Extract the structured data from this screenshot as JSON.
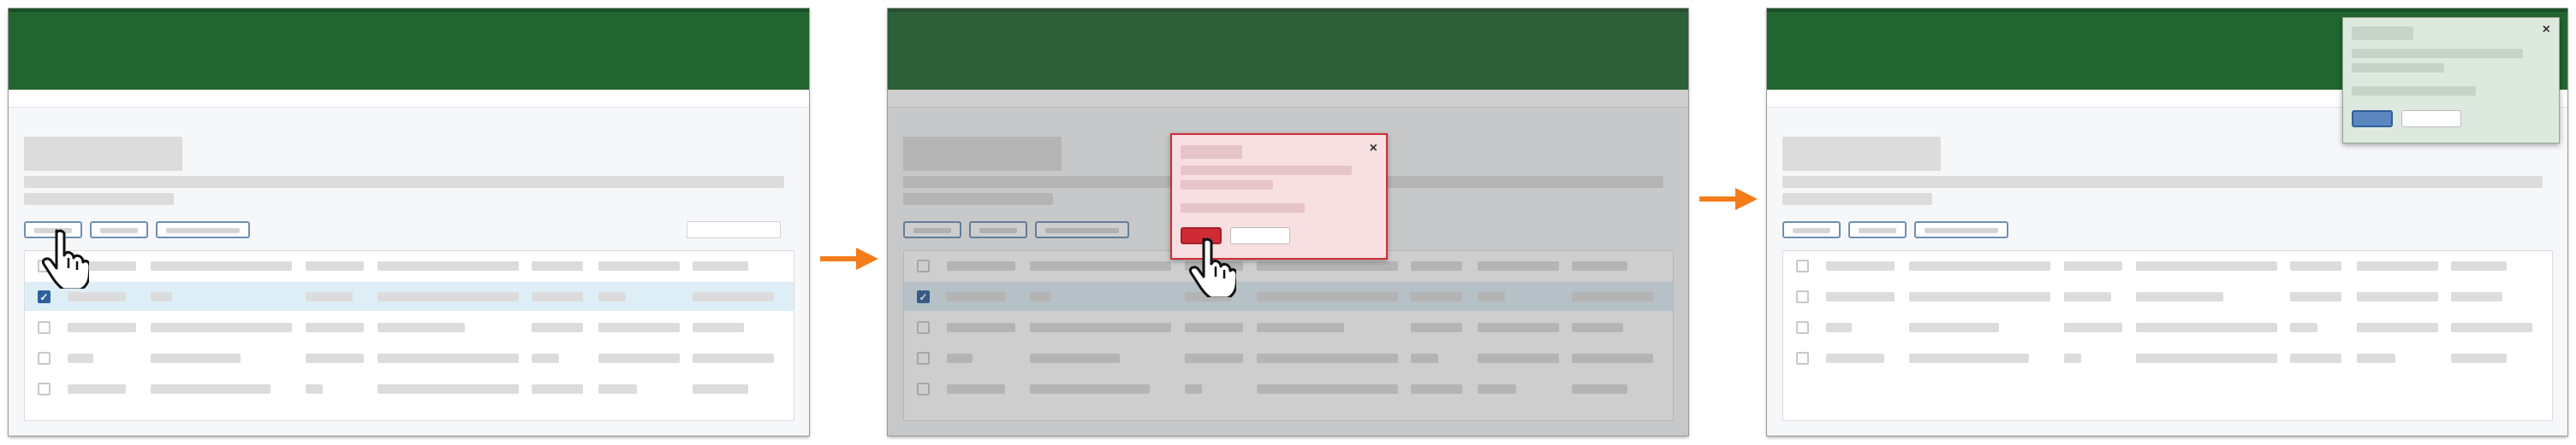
{
  "steps": [
    {
      "id": "step-1",
      "selected_row": 2
    },
    {
      "id": "step-2",
      "selected_row": 2
    },
    {
      "id": "step-3",
      "selected_row": null
    }
  ],
  "modal": {
    "close_glyph": "×"
  },
  "toast": {
    "close_glyph": "×"
  },
  "checkbox": {
    "check_glyph": "✓"
  },
  "colors": {
    "header": "#216630",
    "accent_arrow": "#f47c1a",
    "danger": "#cf2b36",
    "modal_bg": "#f7dfe2",
    "toast_bg": "#dde9de",
    "primary": "#2e5f9c",
    "selected_row": "#deeef6"
  },
  "icons": [
    "hand-pointer-icon",
    "arrow-right-icon",
    "close-icon",
    "checkbox-icon"
  ]
}
